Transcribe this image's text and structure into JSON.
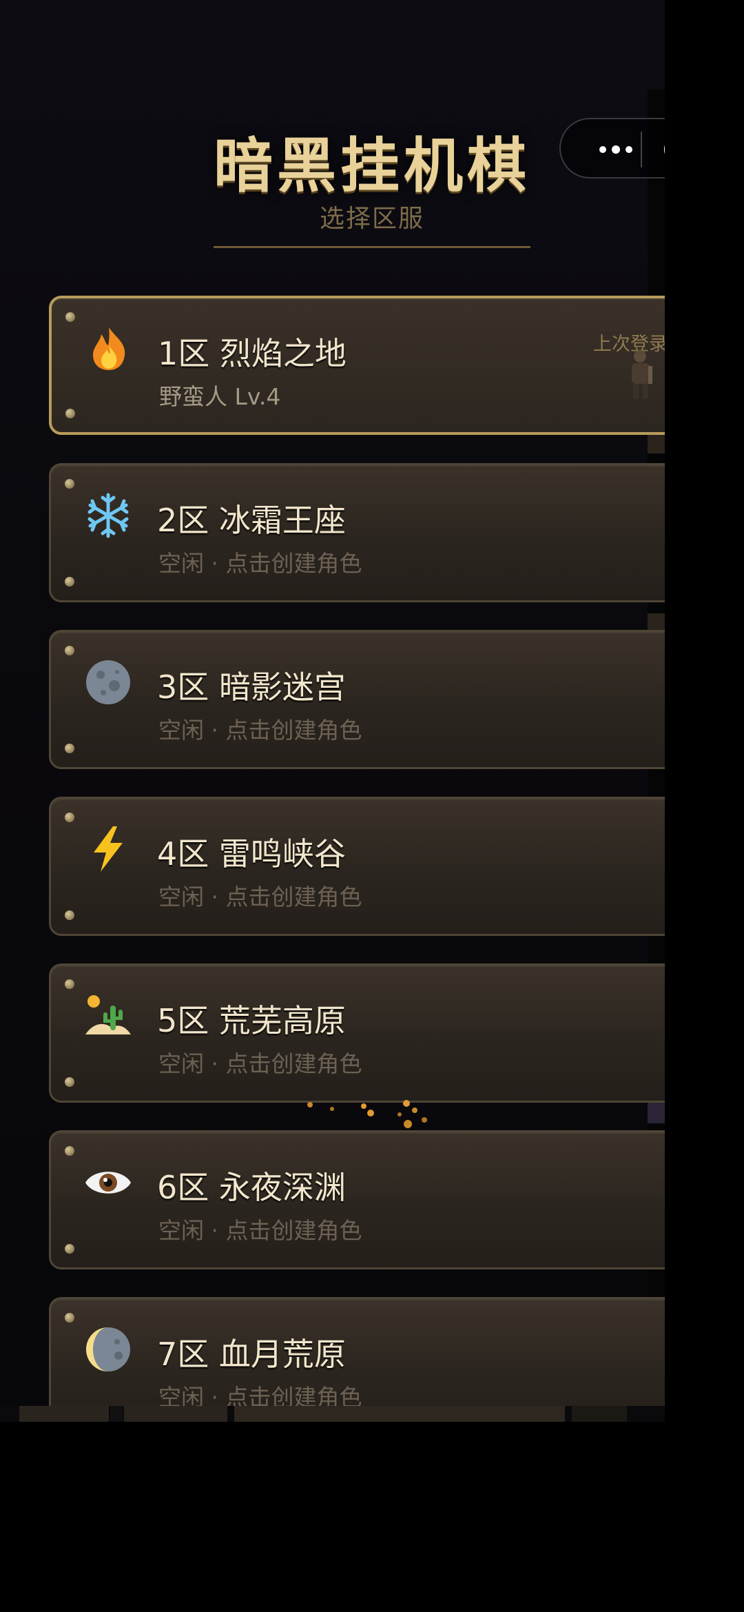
{
  "app": {
    "title": "暗黑挂机棋",
    "subtitle": "选择区服"
  },
  "capsule": {
    "more_icon": "more-dots-icon",
    "close_icon": "target-close-icon"
  },
  "servers": [
    {
      "title": "1区 烈焰之地",
      "subtitle": "野蛮人  Lv.4",
      "icon": "fire-icon",
      "active": true,
      "badge": "上次登录"
    },
    {
      "title": "2区 冰霜王座",
      "subtitle": "空闲 · 点击创建角色",
      "icon": "snowflake-icon"
    },
    {
      "title": "3区 暗影迷宫",
      "subtitle": "空闲 · 点击创建角色",
      "icon": "moon-icon"
    },
    {
      "title": "4区 雷鸣峡谷",
      "subtitle": "空闲 · 点击创建角色",
      "icon": "lightning-icon"
    },
    {
      "title": "5区 荒芜高原",
      "subtitle": "空闲 · 点击创建角色",
      "icon": "desert-icon"
    },
    {
      "title": "6区 永夜深渊",
      "subtitle": "空闲 · 点击创建角色",
      "icon": "eye-icon"
    },
    {
      "title": "7区 血月荒原",
      "subtitle": "空闲 · 点击创建角色",
      "icon": "crescent-moon-icon"
    }
  ],
  "colors": {
    "accent_gold": "#e9d29a",
    "active_border": "#b89c5a",
    "card_bg": "#2c2620"
  }
}
